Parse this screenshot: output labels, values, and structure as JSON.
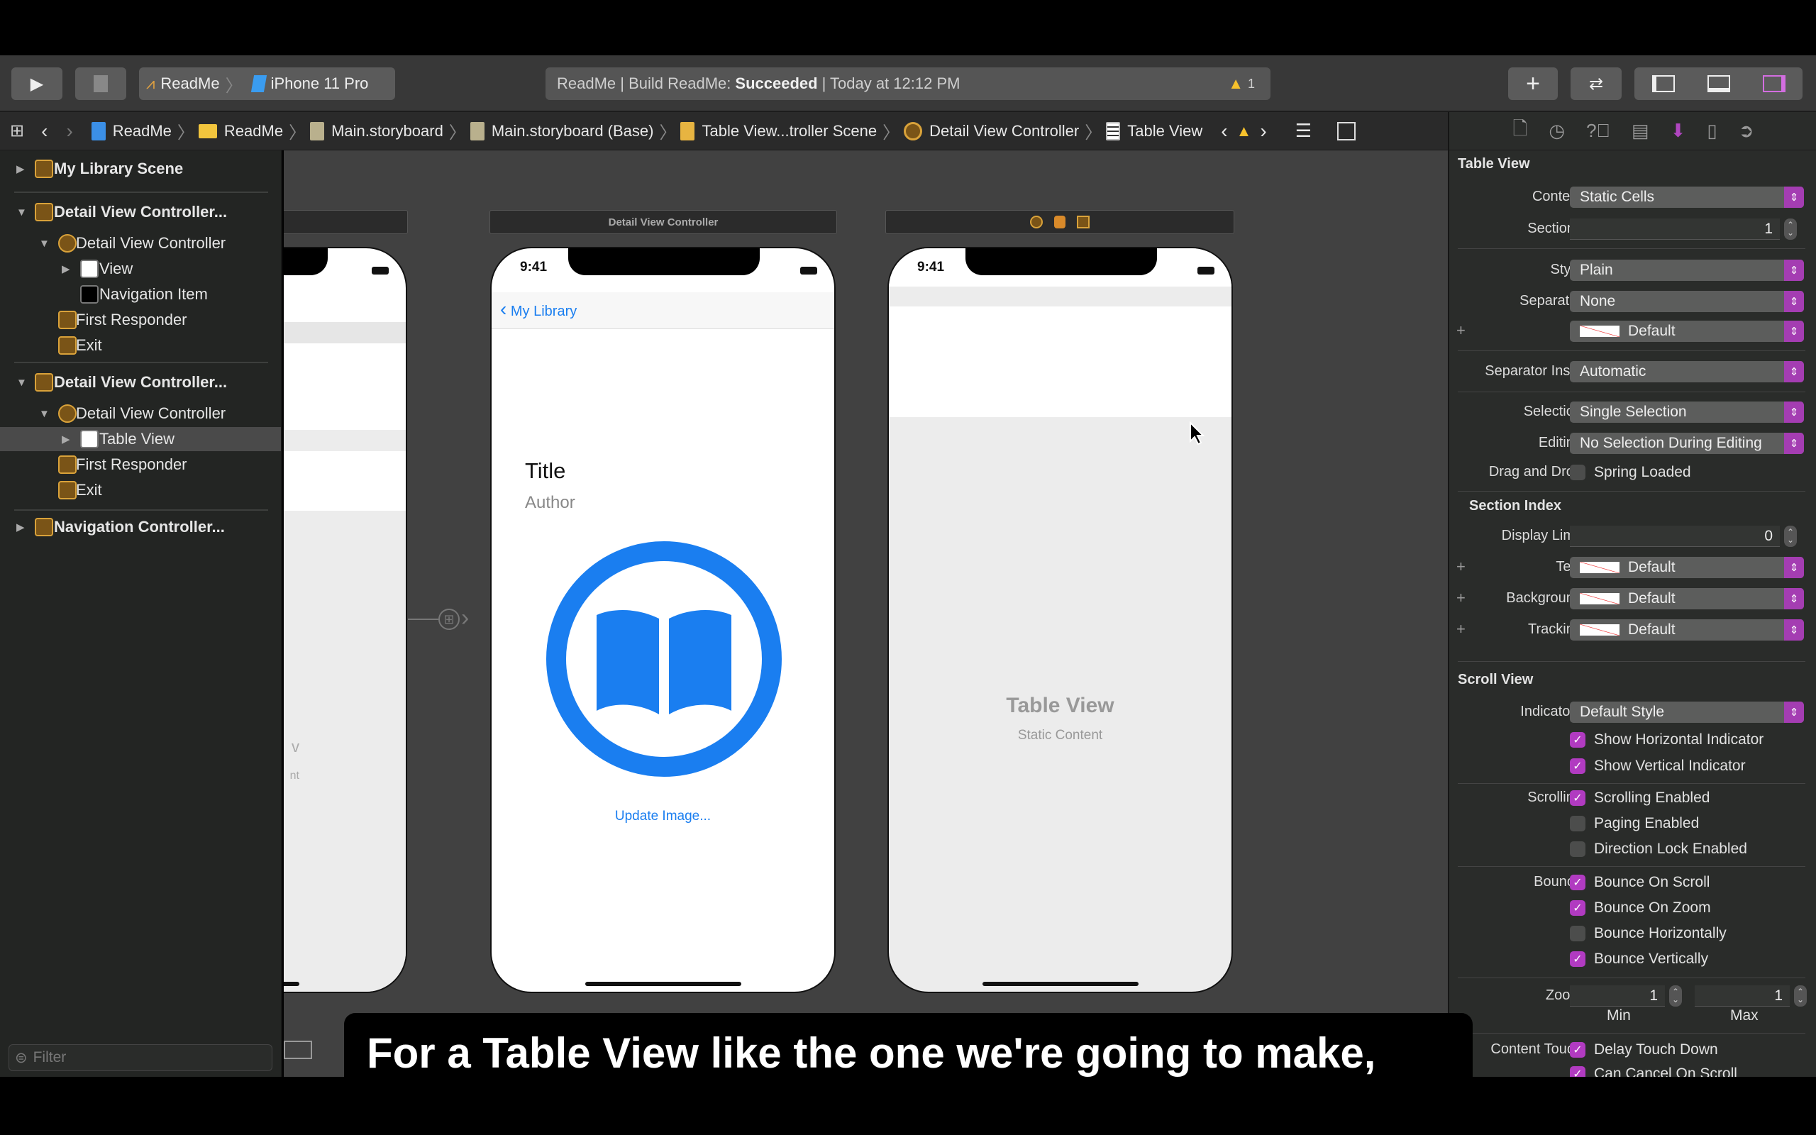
{
  "toolbar": {
    "scheme": "ReadMe",
    "device": "iPhone 11 Pro",
    "activity_prefix": "ReadMe | Build ReadMe:",
    "activity_status": "Succeeded",
    "activity_time": "| Today at 12:12 PM",
    "warning_count": "1"
  },
  "breadcrumb": [
    "ReadMe",
    "ReadMe",
    "Main.storyboard",
    "Main.storyboard (Base)",
    "Table View...troller Scene",
    "Detail View Controller",
    "Table View"
  ],
  "navigator": {
    "items": [
      {
        "label": "My Library Scene",
        "bold": true
      },
      {
        "label": "Detail View Controller...",
        "bold": true
      },
      {
        "label": "Detail View Controller"
      },
      {
        "label": "View"
      },
      {
        "label": "Navigation Item"
      },
      {
        "label": "First Responder"
      },
      {
        "label": "Exit"
      },
      {
        "label": "Detail View Controller...",
        "bold": true
      },
      {
        "label": "Detail View Controller"
      },
      {
        "label": "Table View",
        "selected": true
      },
      {
        "label": "First Responder"
      },
      {
        "label": "Exit"
      },
      {
        "label": "Navigation Controller...",
        "bold": true
      }
    ],
    "filter_placeholder": "Filter"
  },
  "canvas": {
    "left_scene": {
      "partial_title": "v",
      "partial_subtitle": "nt"
    },
    "detail_scene": {
      "header": "Detail View Controller",
      "time": "9:41",
      "back_label": "My Library",
      "title": "Title",
      "author": "Author",
      "update_image": "Update Image...",
      "accent": "#1a7ef0"
    },
    "table_scene": {
      "time": "9:41",
      "placeholder_title": "Table View",
      "placeholder_subtitle": "Static Content"
    }
  },
  "inspector": {
    "table_view": {
      "title": "Table View",
      "content_label": "Content",
      "content": "Static Cells",
      "sections_label": "Sections",
      "sections": "1",
      "style_label": "Style",
      "style": "Plain",
      "separator_label": "Separator",
      "separator": "None",
      "separator_color": "Default",
      "separator_inset_label": "Separator Inset",
      "separator_inset": "Automatic",
      "selection_label": "Selection",
      "selection": "Single Selection",
      "editing_label": "Editing",
      "editing": "No Selection During Editing",
      "drag_drop_label": "Drag and Drop",
      "spring_loaded": "Spring Loaded",
      "spring_loaded_checked": false
    },
    "section_index": {
      "title": "Section Index",
      "display_limit_label": "Display Limit",
      "display_limit": "0",
      "text_label": "Text",
      "text": "Default",
      "background_label": "Background",
      "background": "Default",
      "tracking_label": "Tracking",
      "tracking": "Default"
    },
    "scroll_view": {
      "title": "Scroll View",
      "indicators_label": "Indicators",
      "indicators": "Default Style",
      "scrolling_label": "Scrolling",
      "bounce_label": "Bounce",
      "zoom_label": "Zoom",
      "zoom_min": "1",
      "zoom_max": "1",
      "min_label": "Min",
      "max_label": "Max",
      "content_touch_label": "Content Touch",
      "checks": [
        {
          "option": "Show Horizontal Indicator",
          "checked": true
        },
        {
          "option": "Show Vertical Indicator",
          "checked": true
        },
        {
          "option": "Scrolling Enabled",
          "checked": true
        },
        {
          "option": "Paging Enabled",
          "checked": false
        },
        {
          "option": "Direction Lock Enabled",
          "checked": false
        },
        {
          "option": "Bounce On Scroll",
          "checked": true
        },
        {
          "option": "Bounce On Zoom",
          "checked": true
        },
        {
          "option": "Bounce Horizontally",
          "checked": false
        },
        {
          "option": "Bounce Vertically",
          "checked": true
        },
        {
          "option": "Delay Touch Down",
          "checked": true
        },
        {
          "option": "Can Cancel On Scroll",
          "checked": true
        }
      ]
    },
    "accent": "#b13bc1"
  },
  "subtitle": "For a Table View like the one we're going to make,"
}
